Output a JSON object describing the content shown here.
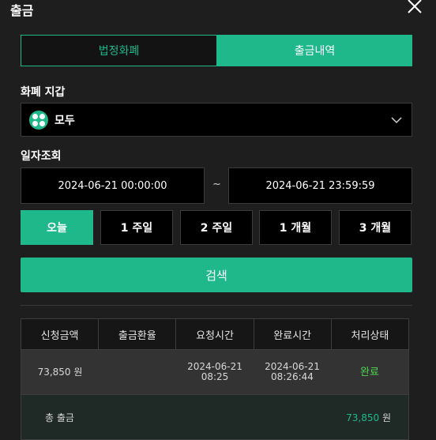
{
  "header": {
    "title": "출금",
    "close_icon": "close-icon"
  },
  "tabs": [
    {
      "label": "법정화폐",
      "active": false
    },
    {
      "label": "출금내역",
      "active": true
    }
  ],
  "wallet": {
    "label": "화폐 지갑",
    "selected": "모두",
    "icon": "coin-icon"
  },
  "date_query": {
    "label": "일자조회",
    "start": "2024-06-21 00:00:00",
    "separator": "~",
    "end": "2024-06-21 23:59:59"
  },
  "quick_ranges": [
    {
      "label": "오늘",
      "active": true
    },
    {
      "label": "1 주일",
      "active": false
    },
    {
      "label": "2 주일",
      "active": false
    },
    {
      "label": "1 개월",
      "active": false
    },
    {
      "label": "3 개월",
      "active": false
    }
  ],
  "search_label": "검색",
  "table": {
    "headers": [
      "신청금액",
      "출금환율",
      "요청시간",
      "완료시간",
      "처리상태"
    ],
    "rows": [
      {
        "amount": "73,850 원",
        "rate": "",
        "request_date": "2024-06-21",
        "request_time": "08:25",
        "complete_date": "2024-06-21",
        "complete_time": "08:26:44",
        "status": "완료"
      }
    ],
    "footer": {
      "label": "총 출금",
      "amount": "73,850",
      "unit": "원"
    }
  },
  "colors": {
    "accent": "#1fb88a",
    "status_done": "#4fd64f",
    "background": "#1e1e1e"
  }
}
